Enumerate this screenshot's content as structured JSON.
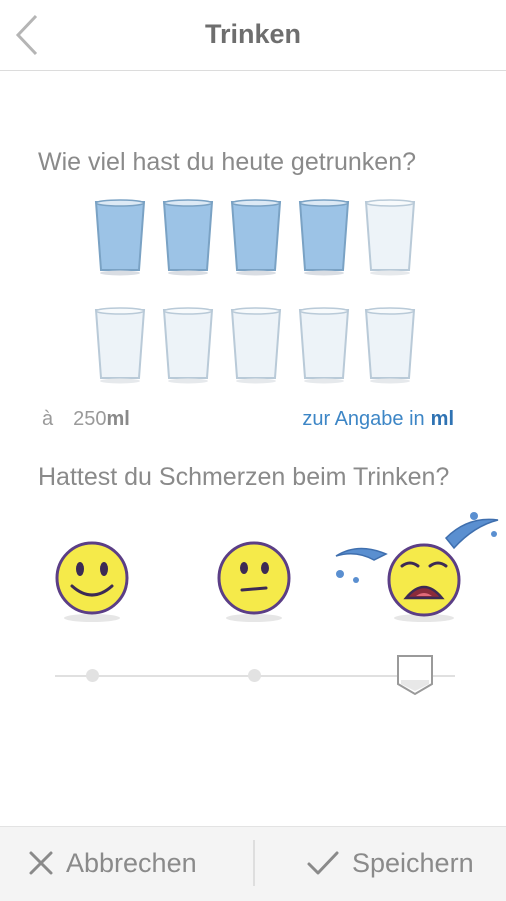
{
  "header": {
    "title": "Trinken"
  },
  "question_drink": "Wie viel hast du heute getrunken?",
  "glasses": {
    "filled": 4,
    "total": 10
  },
  "unit_prefix": "à",
  "unit_amount": "250",
  "unit_suffix": "ml",
  "unit_link_text": "zur Angabe in",
  "unit_link_unit": "ml",
  "question_pain": "Hattest du Schmerzen beim Trinken?",
  "pain_slider": {
    "level": 2,
    "max": 2
  },
  "footer": {
    "cancel_label": "Abbrechen",
    "save_label": "Speichern"
  },
  "colors": {
    "accent": "#3d86c6",
    "water": "#9cc3e6",
    "smiley": "#f5ea4a",
    "outline": "#5b3e86"
  }
}
